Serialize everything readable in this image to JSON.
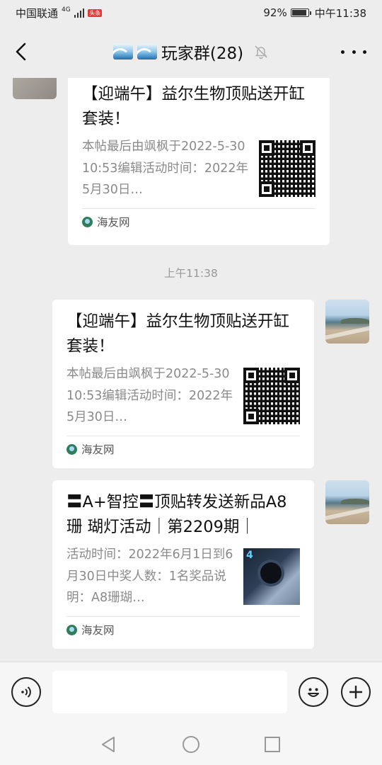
{
  "status_bar": {
    "carrier": "中国联通",
    "network": "4G",
    "news_badge": "头条",
    "battery": "92%",
    "time": "中午11:38"
  },
  "header": {
    "title": "玩家群(28)",
    "icons": [
      "back-arrow-icon",
      "wave-emoji-icon",
      "bell-muted-icon",
      "more-dots-icon"
    ]
  },
  "messages": [
    {
      "side": "left",
      "title": "【迎端午】益尔生物顶贴送开缸套装！",
      "desc": "本帖最后由飒枫于2022-5-3010:53编辑活动时间：2022年5月30日…",
      "source": "海友网",
      "thumb": "qr-code"
    },
    {
      "side": "right",
      "title": "【迎端午】益尔生物顶贴送开缸套装！",
      "desc": "本帖最后由飒枫于2022-5-3010:53编辑活动时间：2022年5月30日…",
      "source": "海友网",
      "thumb": "qr-code"
    },
    {
      "side": "right",
      "title": "〓A+智控〓顶贴转发送新品A8珊 瑚灯活动｜第2209期｜",
      "desc": "活动时间：2022年6月1日到6月30日中奖人数：1名奖品说明：A8珊瑚…",
      "source": "海友网",
      "thumb": "product-photo"
    }
  ],
  "time_label": "上午11:38",
  "input_bar": {
    "value": "",
    "icons": [
      "voice-icon",
      "emoji-icon",
      "plus-icon"
    ]
  },
  "nav_bar": {
    "icons": [
      "nav-back-icon",
      "nav-home-icon",
      "nav-recents-icon"
    ]
  }
}
